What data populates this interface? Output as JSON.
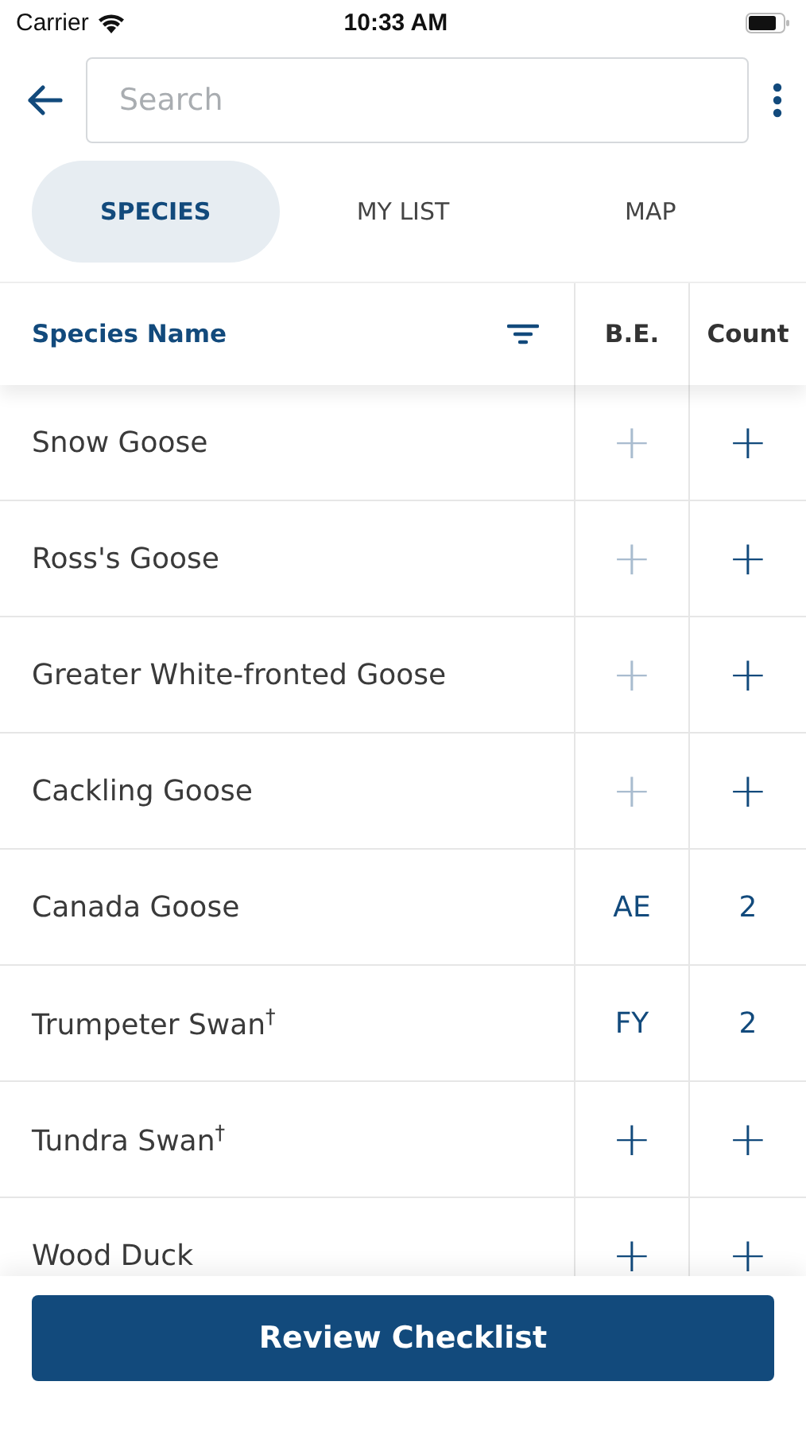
{
  "status_bar": {
    "carrier": "Carrier",
    "time": "10:33 AM"
  },
  "search": {
    "placeholder": "Search"
  },
  "tabs": [
    {
      "label": "SPECIES",
      "selected": true
    },
    {
      "label": "MY LIST",
      "selected": false
    },
    {
      "label": "MAP",
      "selected": false
    }
  ],
  "table": {
    "columns": [
      "Species Name",
      "B.E.",
      "Count"
    ],
    "rows": [
      {
        "name": "Snow Goose",
        "be": {
          "text": "+",
          "disabled": true
        },
        "count": {
          "text": "+",
          "disabled": false
        }
      },
      {
        "name": "Ross's Goose",
        "be": {
          "text": "+",
          "disabled": true
        },
        "count": {
          "text": "+",
          "disabled": false
        }
      },
      {
        "name": "Greater White-fronted Goose",
        "be": {
          "text": "+",
          "disabled": true
        },
        "count": {
          "text": "+",
          "disabled": false
        }
      },
      {
        "name": "Cackling Goose",
        "be": {
          "text": "+",
          "disabled": true
        },
        "count": {
          "text": "+",
          "disabled": false
        }
      },
      {
        "name": "Canada Goose",
        "be": {
          "text": "AE",
          "disabled": false
        },
        "count": {
          "text": "2",
          "disabled": false
        }
      },
      {
        "name": "Trumpeter Swan$^{†}$",
        "be": {
          "text": "FY",
          "disabled": false
        },
        "count": {
          "text": "2",
          "disabled": false
        }
      },
      {
        "name": "Tundra Swan$^{†}$",
        "be": {
          "text": "+",
          "disabled": false
        },
        "count": {
          "text": "+",
          "disabled": false
        }
      },
      {
        "name": "Wood Duck",
        "be": {
          "text": "+",
          "disabled": false
        },
        "count": {
          "text": "+",
          "disabled": false
        }
      }
    ]
  },
  "footer": {
    "button": "Review Checklist"
  }
}
